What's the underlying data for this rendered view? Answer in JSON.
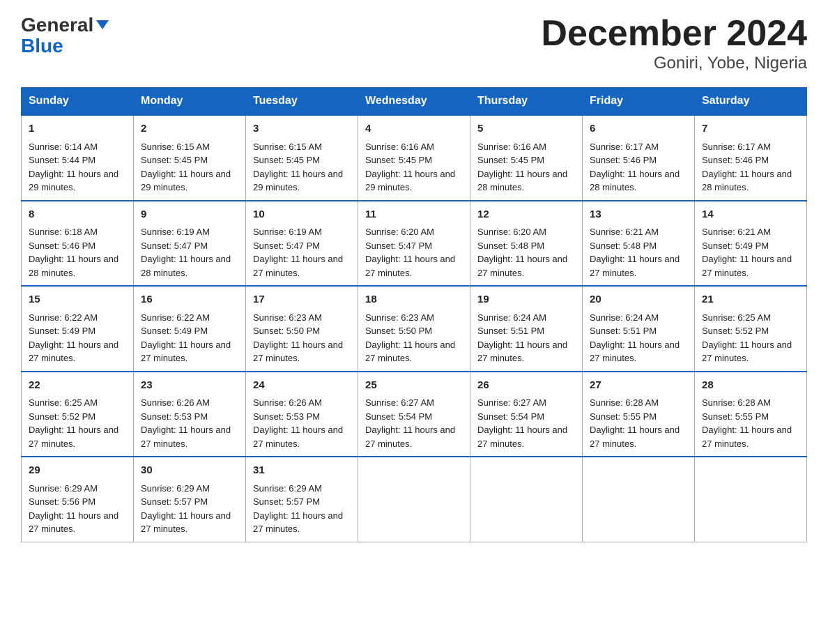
{
  "logo": {
    "line1": "General",
    "triangle": "▲",
    "line2": "Blue"
  },
  "title": "December 2024",
  "subtitle": "Goniri, Yobe, Nigeria",
  "days": [
    "Sunday",
    "Monday",
    "Tuesday",
    "Wednesday",
    "Thursday",
    "Friday",
    "Saturday"
  ],
  "weeks": [
    [
      {
        "num": "1",
        "sunrise": "6:14 AM",
        "sunset": "5:44 PM",
        "daylight": "11 hours and 29 minutes."
      },
      {
        "num": "2",
        "sunrise": "6:15 AM",
        "sunset": "5:45 PM",
        "daylight": "11 hours and 29 minutes."
      },
      {
        "num": "3",
        "sunrise": "6:15 AM",
        "sunset": "5:45 PM",
        "daylight": "11 hours and 29 minutes."
      },
      {
        "num": "4",
        "sunrise": "6:16 AM",
        "sunset": "5:45 PM",
        "daylight": "11 hours and 29 minutes."
      },
      {
        "num": "5",
        "sunrise": "6:16 AM",
        "sunset": "5:45 PM",
        "daylight": "11 hours and 28 minutes."
      },
      {
        "num": "6",
        "sunrise": "6:17 AM",
        "sunset": "5:46 PM",
        "daylight": "11 hours and 28 minutes."
      },
      {
        "num": "7",
        "sunrise": "6:17 AM",
        "sunset": "5:46 PM",
        "daylight": "11 hours and 28 minutes."
      }
    ],
    [
      {
        "num": "8",
        "sunrise": "6:18 AM",
        "sunset": "5:46 PM",
        "daylight": "11 hours and 28 minutes."
      },
      {
        "num": "9",
        "sunrise": "6:19 AM",
        "sunset": "5:47 PM",
        "daylight": "11 hours and 28 minutes."
      },
      {
        "num": "10",
        "sunrise": "6:19 AM",
        "sunset": "5:47 PM",
        "daylight": "11 hours and 27 minutes."
      },
      {
        "num": "11",
        "sunrise": "6:20 AM",
        "sunset": "5:47 PM",
        "daylight": "11 hours and 27 minutes."
      },
      {
        "num": "12",
        "sunrise": "6:20 AM",
        "sunset": "5:48 PM",
        "daylight": "11 hours and 27 minutes."
      },
      {
        "num": "13",
        "sunrise": "6:21 AM",
        "sunset": "5:48 PM",
        "daylight": "11 hours and 27 minutes."
      },
      {
        "num": "14",
        "sunrise": "6:21 AM",
        "sunset": "5:49 PM",
        "daylight": "11 hours and 27 minutes."
      }
    ],
    [
      {
        "num": "15",
        "sunrise": "6:22 AM",
        "sunset": "5:49 PM",
        "daylight": "11 hours and 27 minutes."
      },
      {
        "num": "16",
        "sunrise": "6:22 AM",
        "sunset": "5:49 PM",
        "daylight": "11 hours and 27 minutes."
      },
      {
        "num": "17",
        "sunrise": "6:23 AM",
        "sunset": "5:50 PM",
        "daylight": "11 hours and 27 minutes."
      },
      {
        "num": "18",
        "sunrise": "6:23 AM",
        "sunset": "5:50 PM",
        "daylight": "11 hours and 27 minutes."
      },
      {
        "num": "19",
        "sunrise": "6:24 AM",
        "sunset": "5:51 PM",
        "daylight": "11 hours and 27 minutes."
      },
      {
        "num": "20",
        "sunrise": "6:24 AM",
        "sunset": "5:51 PM",
        "daylight": "11 hours and 27 minutes."
      },
      {
        "num": "21",
        "sunrise": "6:25 AM",
        "sunset": "5:52 PM",
        "daylight": "11 hours and 27 minutes."
      }
    ],
    [
      {
        "num": "22",
        "sunrise": "6:25 AM",
        "sunset": "5:52 PM",
        "daylight": "11 hours and 27 minutes."
      },
      {
        "num": "23",
        "sunrise": "6:26 AM",
        "sunset": "5:53 PM",
        "daylight": "11 hours and 27 minutes."
      },
      {
        "num": "24",
        "sunrise": "6:26 AM",
        "sunset": "5:53 PM",
        "daylight": "11 hours and 27 minutes."
      },
      {
        "num": "25",
        "sunrise": "6:27 AM",
        "sunset": "5:54 PM",
        "daylight": "11 hours and 27 minutes."
      },
      {
        "num": "26",
        "sunrise": "6:27 AM",
        "sunset": "5:54 PM",
        "daylight": "11 hours and 27 minutes."
      },
      {
        "num": "27",
        "sunrise": "6:28 AM",
        "sunset": "5:55 PM",
        "daylight": "11 hours and 27 minutes."
      },
      {
        "num": "28",
        "sunrise": "6:28 AM",
        "sunset": "5:55 PM",
        "daylight": "11 hours and 27 minutes."
      }
    ],
    [
      {
        "num": "29",
        "sunrise": "6:29 AM",
        "sunset": "5:56 PM",
        "daylight": "11 hours and 27 minutes."
      },
      {
        "num": "30",
        "sunrise": "6:29 AM",
        "sunset": "5:57 PM",
        "daylight": "11 hours and 27 minutes."
      },
      {
        "num": "31",
        "sunrise": "6:29 AM",
        "sunset": "5:57 PM",
        "daylight": "11 hours and 27 minutes."
      },
      null,
      null,
      null,
      null
    ]
  ],
  "labels": {
    "sunrise_prefix": "Sunrise: ",
    "sunset_prefix": "Sunset: ",
    "daylight_prefix": "Daylight: "
  }
}
